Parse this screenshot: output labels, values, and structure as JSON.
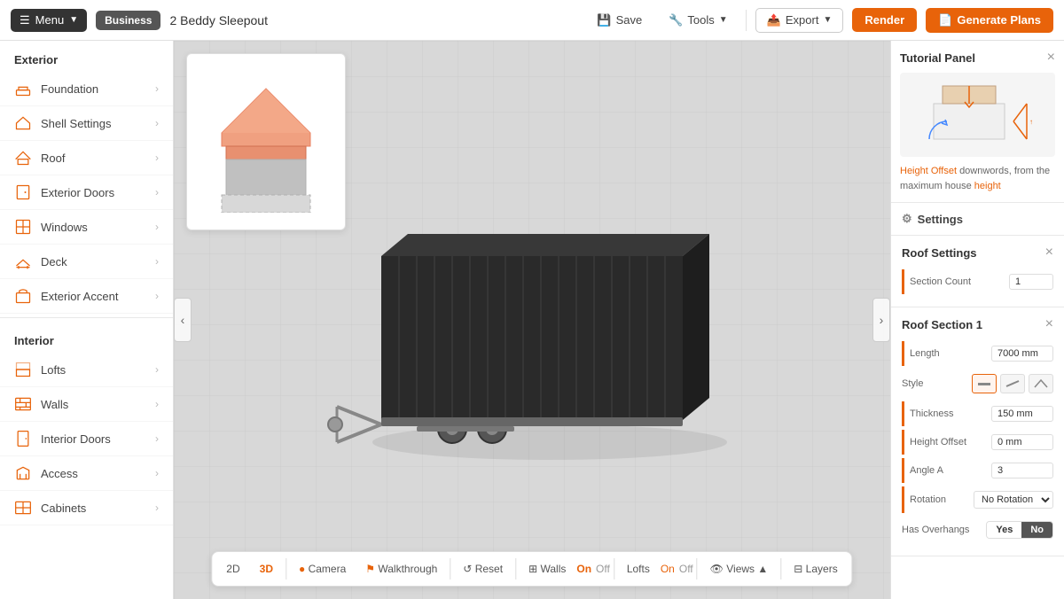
{
  "topbar": {
    "menu_label": "Menu",
    "business_label": "Business",
    "project_title": "2 Beddy Sleepout",
    "save_label": "Save",
    "tools_label": "Tools",
    "export_label": "Export",
    "render_label": "Render",
    "generate_label": "Generate Plans"
  },
  "sidebar": {
    "exterior_title": "Exterior",
    "interior_title": "Interior",
    "exterior_items": [
      {
        "id": "foundation",
        "label": "Foundation"
      },
      {
        "id": "shell-settings",
        "label": "Shell Settings"
      },
      {
        "id": "roof",
        "label": "Roof"
      },
      {
        "id": "exterior-doors",
        "label": "Exterior Doors"
      },
      {
        "id": "windows",
        "label": "Windows"
      },
      {
        "id": "deck",
        "label": "Deck"
      },
      {
        "id": "exterior-accent",
        "label": "Exterior Accent"
      }
    ],
    "interior_items": [
      {
        "id": "lofts",
        "label": "Lofts"
      },
      {
        "id": "walls",
        "label": "Walls"
      },
      {
        "id": "interior-doors",
        "label": "Interior Doors"
      },
      {
        "id": "access",
        "label": "Access"
      },
      {
        "id": "cabinets",
        "label": "Cabinets"
      }
    ]
  },
  "tutorial_panel": {
    "title": "Tutorial Panel",
    "description_part1": "Height Offset",
    "description_text": " downwords, from the maximum house ",
    "description_part2": "height"
  },
  "settings_section": {
    "label": "Settings"
  },
  "roof_settings": {
    "title": "Roof Settings",
    "section_count_label": "Section Count",
    "section_count_value": "1"
  },
  "roof_section": {
    "title": "Roof Section 1",
    "length_label": "Length",
    "length_value": "7000 mm",
    "style_label": "Style",
    "thickness_label": "Thickness",
    "thickness_value": "150 mm",
    "height_offset_label": "Height Offset",
    "height_offset_value": "0 mm",
    "angle_a_label": "Angle A",
    "angle_a_value": "3",
    "rotation_label": "Rotation",
    "rotation_value": "No Rotation",
    "has_overhangs_label": "Has Overhangs",
    "has_overhangs_yes": "Yes",
    "has_overhangs_no": "No"
  },
  "bottom_toolbar": {
    "btn_2d": "2D",
    "btn_3d": "3D",
    "camera_label": "Camera",
    "walkthrough_label": "Walkthrough",
    "reset_label": "Reset",
    "walls_label": "Walls",
    "on_label": "On",
    "off_label": "Off",
    "lofts_label": "Lofts",
    "views_label": "Views",
    "layers_label": "Layers"
  }
}
